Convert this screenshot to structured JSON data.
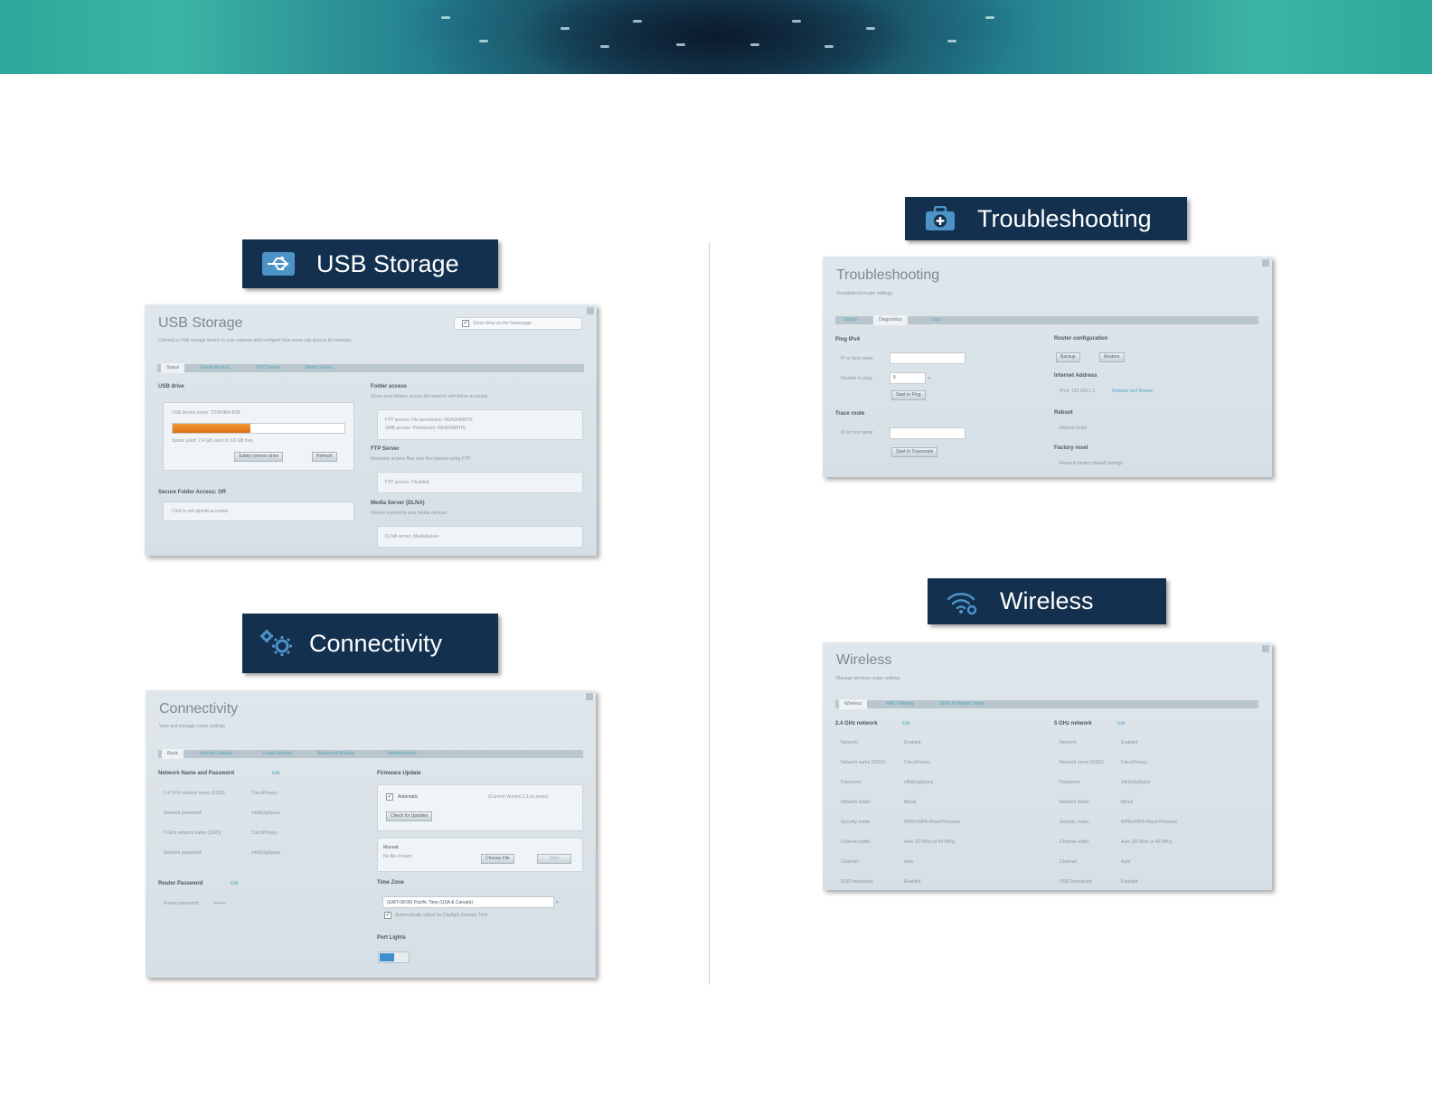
{
  "cards": {
    "usb": {
      "tag_label": "USB Storage",
      "title": "USB Storage",
      "subtitle": "Connect a USB storage device to your network and configure how users can access its contents.",
      "show_drive": "Show drive on the homepage",
      "tabs": [
        "Status",
        "Folder Access",
        "FTP Server",
        "Media Server"
      ],
      "usb_drive_heading": "USB drive",
      "drive_name": "USB device name: TOSHIBA 4GB",
      "drive_space": "Space used: 2.4 GB used of 3.8 GB free",
      "drive_fill": 0.45,
      "safely_remove": "Safely remove drive",
      "refresh": "Refresh",
      "secure_heading": "Secure Folder Access: Off",
      "secure_text": "Click to set up/edit accounts",
      "folder_heading": "Folder access",
      "folder_sub": "Share your folders across the network with these accounts.",
      "folder_line1": "FTP access: File permission: READ/WRITE",
      "folder_line2": "SMB access: Permission: READ/WRITE",
      "ftp_heading": "FTP Server",
      "ftp_sub": "Remotely access files over the internet using FTP.",
      "ftp_value": "FTP access: Disabled",
      "media_heading": "Media Server (DLNA)",
      "media_sub": "Stream content to your media devices.",
      "media_value": "DLNA server: MediaServer"
    },
    "connectivity": {
      "tag_label": "Connectivity",
      "title": "Connectivity",
      "subtitle": "View and manage router settings",
      "tabs": [
        "Basic",
        "Internet Settings",
        "Local Network",
        "Advanced Routing",
        "Administration"
      ],
      "network_heading": "Network Name and Password",
      "edit": "Edit",
      "rows": [
        {
          "k": "2.4 GHz network name (SSID):",
          "v": "CiscoPrivacy"
        },
        {
          "k": "Network password:",
          "v": "s4k6k3g3paux"
        },
        {
          "k": "5 GHz network name (SSID):",
          "v": "CiscoPrivacy"
        },
        {
          "k": "Network password:",
          "v": "s4k6k3g3paux"
        }
      ],
      "router_pw_heading": "Router Password",
      "router_pw_label": "Router password:",
      "router_pw_value": "••••••••",
      "firmware_heading": "Firmware Update",
      "auto_label": "Automatic",
      "current_fw": "(Current Version 2.1.xx.xxxxx)",
      "check_updates": "Check for Updates",
      "manual_label": "Manual:",
      "manual_sub": "No file chosen",
      "choose_file": "Choose File",
      "start": "Start",
      "timezone_heading": "Time Zone",
      "timezone_value": "(GMT-08:00) Pacific Time (USA & Canada)",
      "dst": "Automatically adjust for Daylight Savings Time",
      "port_lights": "Port Lights"
    },
    "troubleshooting": {
      "tag_label": "Troubleshooting",
      "title": "Troubleshooting",
      "subtitle": "Troubleshoot router settings",
      "tabs": [
        "Status",
        "Diagnostics",
        "Logs"
      ],
      "ping_heading": "Ping IPv4",
      "ip_label": "IP or host name:",
      "times_label": "Number to ping:",
      "times_value": "5",
      "start_ping": "Start to Ping",
      "trace_heading": "Trace route",
      "trace_ip_label": "IP or host name:",
      "start_trace": "Start to Traceroute",
      "router_config": "Router configuration",
      "backup": "Backup",
      "restore": "Restore",
      "internet_address": "Internet Address",
      "ipv4_text": "IPv4: 192.168.1.1",
      "release_link": "Release and Renew",
      "reboot": "Reboot",
      "reboot_text": "Reboot router",
      "factory_reset": "Factory reset",
      "factory_text": "Reset to factory default settings"
    },
    "wireless": {
      "tag_label": "Wireless",
      "title": "Wireless",
      "subtitle": "Manage wireless router settings",
      "tabs": [
        "Wireless",
        "MAC Filtering",
        "Wi-Fi Protected Setup"
      ],
      "left_heading": "2.4 GHz network",
      "right_heading": "5 GHz network",
      "edit": "Edit",
      "rows_left": [
        {
          "k": "Network:",
          "v": "Enabled"
        },
        {
          "k": "Network name (SSID):",
          "v": "CiscoPrivacy"
        },
        {
          "k": "Password:",
          "v": "s4k6k3g3paux"
        },
        {
          "k": "Network mode:",
          "v": "Mixed"
        },
        {
          "k": "Security mode:",
          "v": "WPA2/WPA Mixed Personal"
        },
        {
          "k": "Channel width:",
          "v": "Auto (20 MHz or 40 MHz)"
        },
        {
          "k": "Channel:",
          "v": "Auto"
        },
        {
          "k": "SSID broadcast:",
          "v": "Enabled"
        }
      ],
      "rows_right": [
        {
          "k": "Network:",
          "v": "Enabled"
        },
        {
          "k": "Network name (SSID):",
          "v": "CiscoPrivacy"
        },
        {
          "k": "Password:",
          "v": "s4k6k3g3paux"
        },
        {
          "k": "Network mode:",
          "v": "Mixed"
        },
        {
          "k": "Security mode:",
          "v": "WPA2/WPA Mixed Personal"
        },
        {
          "k": "Channel width:",
          "v": "Auto (20 MHz or 40 MHz)"
        },
        {
          "k": "Channel:",
          "v": "Auto"
        },
        {
          "k": "SSID broadcast:",
          "v": "Enabled"
        }
      ]
    }
  }
}
